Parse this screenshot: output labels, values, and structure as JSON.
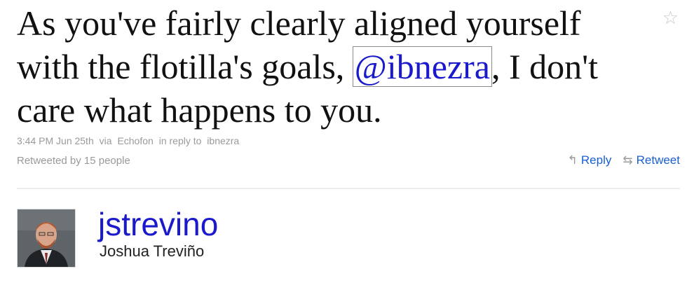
{
  "tweet": {
    "text_before": "As you've fairly clearly aligned yourself with the flotilla's goals, ",
    "mention": "@ibnezra",
    "text_after": ", I don't care what happens to you.",
    "favorite_icon": "star-icon"
  },
  "meta": {
    "time": "3:44 PM Jun 25th",
    "via_label": "via",
    "client": "Echofon",
    "reply_context_label": "in reply to",
    "reply_to_user": "ibnezra",
    "retweeted_by": "Retweeted by 15 people"
  },
  "actions": {
    "reply_label": "Reply",
    "reply_icon": "reply-arrow-icon",
    "retweet_label": "Retweet",
    "retweet_icon": "retweet-icon"
  },
  "author": {
    "username": "jstrevino",
    "full_name": "Joshua Treviño"
  },
  "colors": {
    "link": "#1a1acc",
    "action_link": "#1a5fd1",
    "meta_text": "#9a9a9a",
    "tweet_text": "#111111"
  }
}
